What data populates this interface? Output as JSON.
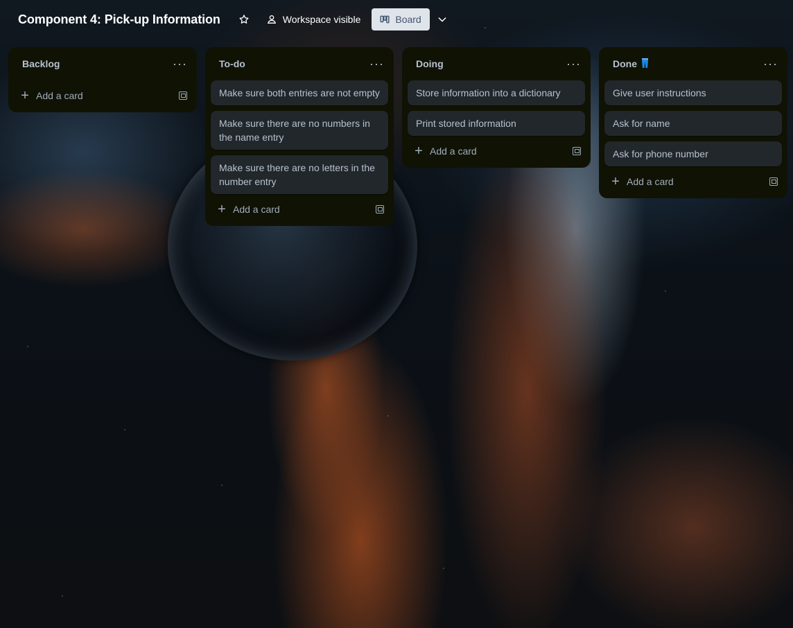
{
  "board": {
    "title": "Component 4: Pick-up Information",
    "visibility_label": "Workspace visible",
    "view_label": "Board"
  },
  "icons": {
    "star": "star-icon",
    "visibility": "people-icon",
    "board_view": "board-view-icon",
    "chevron": "chevron-down-icon",
    "more": "more-horizontal-icon",
    "add": "plus-icon",
    "template": "card-template-icon",
    "done_emoji": "jeans-icon"
  },
  "colors": {
    "list_bg": "#101204",
    "card_bg": "#22272b",
    "text": "#b6c2cf",
    "title": "#ffffff"
  },
  "lists": [
    {
      "title": "Backlog",
      "cards": [],
      "add_label": "Add a card"
    },
    {
      "title": "To-do",
      "cards": [
        "Make sure both entries are not empty",
        "Make sure there are no numbers in the name entry",
        "Make sure there are no letters in the number entry"
      ],
      "add_label": "Add a card"
    },
    {
      "title": "Doing",
      "cards": [
        "Store information into a dictionary",
        "Print stored information"
      ],
      "add_label": "Add a card"
    },
    {
      "title": "Done",
      "cards": [
        "Give user instructions",
        "Ask for name",
        "Ask for phone number"
      ],
      "add_label": "Add a card"
    }
  ]
}
